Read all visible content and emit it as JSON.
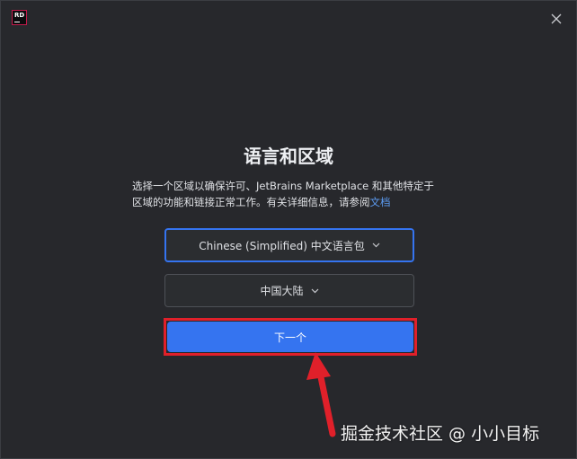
{
  "window": {
    "logo_text": "RD"
  },
  "dialog": {
    "title": "语言和区域",
    "description_line1": "选择一个区域以确保许可、JetBrains Marketplace 和其他特定于",
    "description_line2": "区域的功能和链接正常工作。有关详细信息，请参阅",
    "description_link": "文档",
    "language_select": {
      "value": "Chinese (Simplified) 中文语言包"
    },
    "region_select": {
      "value": "中国大陆"
    },
    "next_button_label": "下一个"
  },
  "watermark": "掘金技术社区 @ 小小目标",
  "colors": {
    "background": "#27282c",
    "accent": "#3574f0",
    "link": "#5c9bf0",
    "annotation": "#e0202a"
  },
  "icons": {
    "close": "close-icon",
    "chevron": "chevron-down-icon",
    "arrow": "red-arrow-annotation"
  }
}
